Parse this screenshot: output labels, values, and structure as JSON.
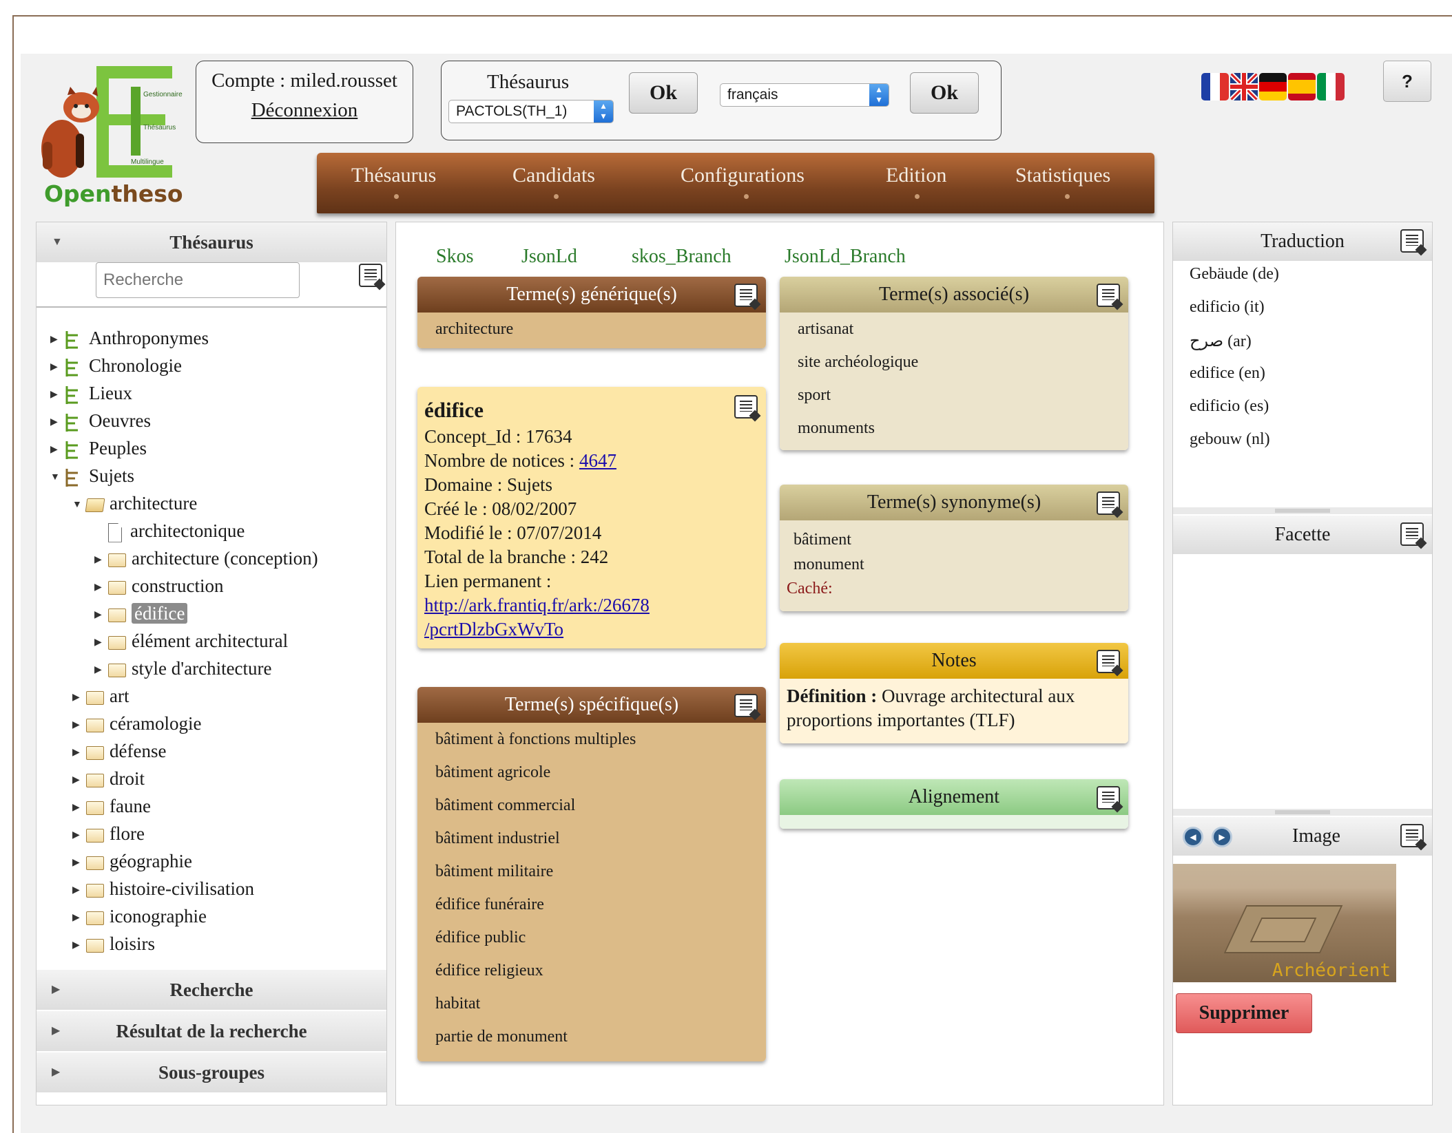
{
  "account": {
    "user_line": "Compte : miled.rousset",
    "logout": "Déconnexion"
  },
  "logo": {
    "word_green": "Open",
    "word_brown": "theso",
    "tag1": "Gestionnaire",
    "tag2": "Thésaurus",
    "tag3": "Multilingue"
  },
  "thesaurus_selector": {
    "label": "Thésaurus",
    "selected": "PACTOLS(TH_1)",
    "ok": "Ok"
  },
  "language_selector": {
    "selected": "français",
    "ok": "Ok"
  },
  "help": "?",
  "flags": [
    "fr",
    "gb",
    "de",
    "es",
    "it"
  ],
  "menu": [
    "Thésaurus",
    "Candidats",
    "Configurations",
    "Edition",
    "Statistiques"
  ],
  "left_panel": {
    "title": "Thésaurus",
    "search_placeholder": "Recherche",
    "tree": [
      {
        "label": "Anthroponymes"
      },
      {
        "label": "Chronologie"
      },
      {
        "label": "Lieux"
      },
      {
        "label": "Oeuvres"
      },
      {
        "label": "Peuples"
      },
      {
        "label": "Sujets"
      },
      {
        "label": "architecture"
      },
      {
        "label": "architectonique"
      },
      {
        "label": "architecture (conception)"
      },
      {
        "label": "construction"
      },
      {
        "label": "édifice"
      },
      {
        "label": "élément architectural"
      },
      {
        "label": "style d'architecture"
      },
      {
        "label": "art"
      },
      {
        "label": "céramologie"
      },
      {
        "label": "défense"
      },
      {
        "label": "droit"
      },
      {
        "label": "faune"
      },
      {
        "label": "flore"
      },
      {
        "label": "géographie"
      },
      {
        "label": "histoire-civilisation"
      },
      {
        "label": "iconographie"
      },
      {
        "label": "loisirs"
      }
    ],
    "sections": [
      "Recherche",
      "Résultat de la recherche",
      "Sous-groupes"
    ]
  },
  "export_links": [
    "Skos",
    "JsonLd",
    "skos_Branch",
    "JsonLd_Branch"
  ],
  "broader": {
    "title": "Terme(s) générique(s)",
    "items": [
      "architecture"
    ]
  },
  "concept": {
    "title": "édifice",
    "id_line": "Concept_Id : 17634",
    "notices_label": "Nombre de notices : ",
    "notices_count": "4647",
    "domain": "Domaine : Sujets",
    "created": "Créé le : 08/02/2007",
    "modified": "Modifié le : 07/07/2014",
    "branch_total": "Total de la branche : 242",
    "permalink_label": "Lien permanent :",
    "permalink_1": "http://ark.frantiq.fr/ark:/26678",
    "permalink_2": "/pcrtDlzbGxWvTo"
  },
  "narrower": {
    "title": "Terme(s) spécifique(s)",
    "items": [
      "bâtiment à fonctions multiples",
      "bâtiment agricole",
      "bâtiment commercial",
      "bâtiment industriel",
      "bâtiment militaire",
      "édifice funéraire",
      "édifice public",
      "édifice religieux",
      "habitat",
      "partie de monument"
    ]
  },
  "related": {
    "title": "Terme(s) associé(s)",
    "items": [
      "artisanat",
      "site archéologique",
      "sport",
      "monuments"
    ]
  },
  "synonyms": {
    "title": "Terme(s) synonyme(s)",
    "items": [
      "bâtiment",
      "monument"
    ],
    "hidden_label": "Caché:"
  },
  "notes": {
    "title": "Notes",
    "definition_label": "Définition :",
    "definition_text": " Ouvrage architectural aux proportions importantes (TLF)"
  },
  "alignment": {
    "title": "Alignement"
  },
  "right_panel": {
    "translation_title": "Traduction",
    "translations": [
      "Gebäude (de)",
      "edificio (it)",
      "صرح (ar)",
      "edifice (en)",
      "edificio (es)",
      "gebouw (nl)"
    ],
    "facet_title": "Facette",
    "image_title": "Image",
    "image_watermark": "Archéorient",
    "delete": "Supprimer"
  },
  "colors": {
    "menu_brown": "#7b4320",
    "link_green": "#2a7a2a",
    "concept_bg": "#fde7a7",
    "delete_red": "#e05a5a"
  }
}
